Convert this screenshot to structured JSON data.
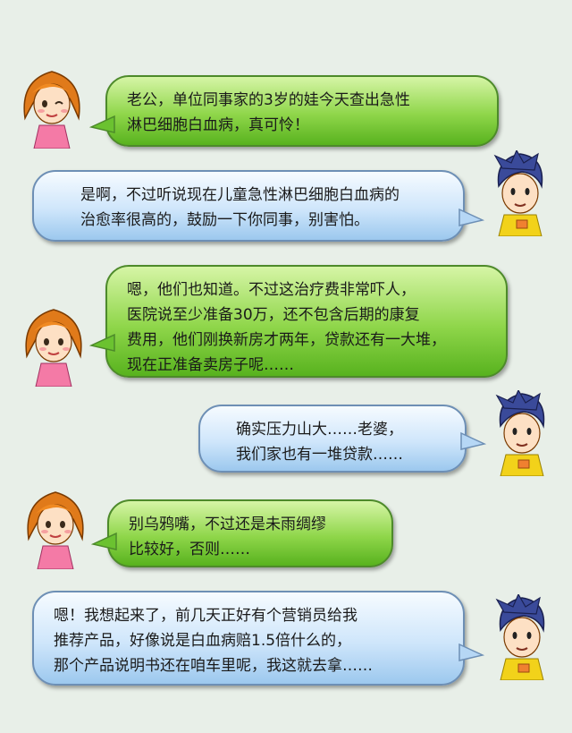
{
  "colors": {
    "background": "#e8efe8",
    "green_bubble": "#8fd64a",
    "blue_bubble": "#cfe6fb"
  },
  "dialogue": [
    {
      "speaker": "wife",
      "lines": [
        "老公，单位同事家的3岁的娃今天查出急性",
        "淋巴细胞白血病，真可怜！"
      ]
    },
    {
      "speaker": "husband",
      "lines": [
        "是啊，不过听说现在儿童急性淋巴细胞白血病的",
        "治愈率很高的，鼓励一下你同事，别害怕。"
      ]
    },
    {
      "speaker": "wife",
      "lines": [
        "嗯，他们也知道。不过这治疗费非常吓人，",
        "医院说至少准备30万，还不包含后期的康复",
        "费用，他们刚换新房才两年，贷款还有一大堆，",
        "现在正准备卖房子呢……"
      ]
    },
    {
      "speaker": "husband",
      "lines": [
        "确实压力山大……老婆，",
        "我们家也有一堆贷款……"
      ]
    },
    {
      "speaker": "wife",
      "lines": [
        "别乌鸦嘴，不过还是未雨绸缪",
        "比较好，否则……"
      ]
    },
    {
      "speaker": "husband",
      "lines": [
        "嗯！我想起来了，前几天正好有个营销员给我",
        "推荐产品，好像说是白血病赔1.5倍什么的，",
        "那个产品说明书还在咱车里呢，我这就去拿……"
      ]
    }
  ]
}
